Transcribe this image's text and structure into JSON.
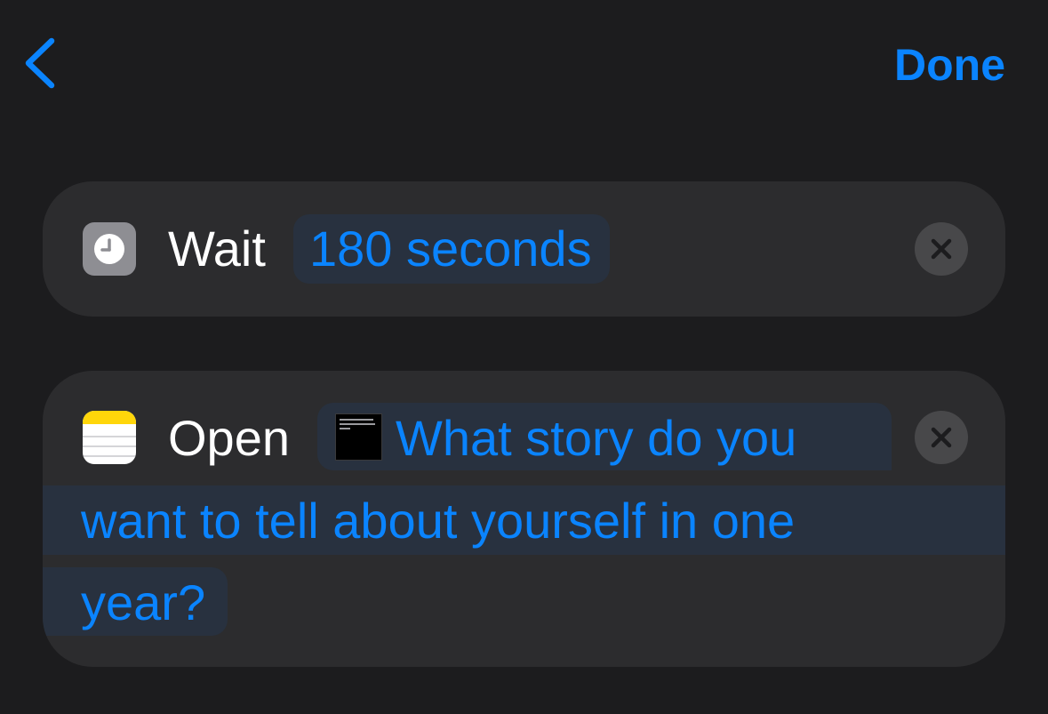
{
  "nav": {
    "back_icon": "chevron-left-icon",
    "done_label": "Done"
  },
  "actions": [
    {
      "app_icon": "clock-app-icon",
      "verb": "Wait",
      "parameter": "180 seconds",
      "remove_icon": "xmark-circle-icon"
    },
    {
      "app_icon": "notes-app-icon",
      "verb": "Open",
      "note_thumbnail_icon": "note-thumbnail-icon",
      "parameter_lines": [
        "What story do you",
        "want to tell about yourself in one",
        "year?"
      ],
      "remove_icon": "xmark-circle-icon"
    }
  ],
  "colors": {
    "background": "#1c1c1e",
    "card": "#2c2c2e",
    "accent": "#0a84ff",
    "token_background": "#28313f",
    "remove_button": "#48484a"
  }
}
